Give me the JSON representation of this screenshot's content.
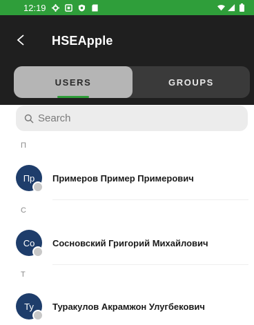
{
  "status_bar": {
    "time": "12:19",
    "icons": [
      "settings-icon",
      "a-badge-icon",
      "shield-icon",
      "sd-card-icon"
    ],
    "right_icons": [
      "wifi-icon",
      "signal-icon",
      "battery-icon"
    ],
    "color": "#2f9e3a"
  },
  "app_bar": {
    "title": "HSEApple",
    "back_icon": "back-arrow-icon"
  },
  "tabs": {
    "users_label": "USERS",
    "groups_label": "GROUPS",
    "active": "USERS"
  },
  "search": {
    "placeholder": "Search",
    "icon": "search-icon"
  },
  "sections": [
    {
      "letter": "П",
      "contacts": [
        {
          "initials": "Пр",
          "name": "Примеров Пример Примерович"
        }
      ]
    },
    {
      "letter": "С",
      "contacts": [
        {
          "initials": "Со",
          "name": "Сосновский Григорий Михайлович"
        }
      ]
    },
    {
      "letter": "Т",
      "contacts": [
        {
          "initials": "Ту",
          "name": "Туракулов Акрамжон Улугбекович"
        }
      ]
    }
  ]
}
